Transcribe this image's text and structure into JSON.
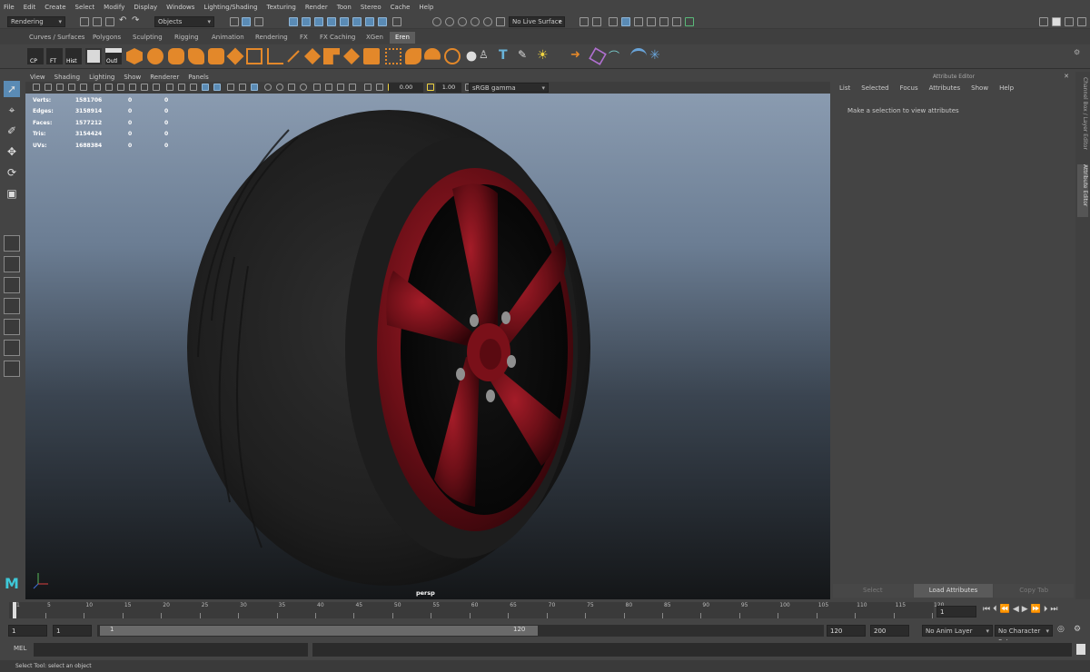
{
  "menubar": [
    "File",
    "Edit",
    "Create",
    "Select",
    "Modify",
    "Display",
    "Windows",
    "Lighting/Shading",
    "Texturing",
    "Render",
    "Toon",
    "Stereo",
    "Cache",
    "Help"
  ],
  "statusline": {
    "mode": "Rendering",
    "selection_mask": "Objects",
    "live_surface": "No Live Surface"
  },
  "shelf_tabs": [
    "Curves / Surfaces",
    "Polygons",
    "Sculpting",
    "Rigging",
    "Animation",
    "Rendering",
    "FX",
    "FX Caching",
    "XGen",
    "Eren"
  ],
  "shelf_active_tab": "Eren",
  "shelf_labels": [
    "CP",
    "FT",
    "Hist",
    "Outl"
  ],
  "viewport": {
    "menu": [
      "View",
      "Shading",
      "Lighting",
      "Show",
      "Renderer",
      "Panels"
    ],
    "exposure": "0.00",
    "gamma": "1.00",
    "color_space": "sRGB gamma",
    "camera": "persp",
    "hud": [
      {
        "label": "Verts:",
        "total": "1581706",
        "sel": "0",
        "comp": "0"
      },
      {
        "label": "Edges:",
        "total": "3158914",
        "sel": "0",
        "comp": "0"
      },
      {
        "label": "Faces:",
        "total": "1577212",
        "sel": "0",
        "comp": "0"
      },
      {
        "label": "Tris:",
        "total": "3154424",
        "sel": "0",
        "comp": "0"
      },
      {
        "label": "UVs:",
        "total": "1688384",
        "sel": "0",
        "comp": "0"
      }
    ]
  },
  "attribute_editor": {
    "title": "Attribute Editor",
    "menu": [
      "List",
      "Selected",
      "Focus",
      "Attributes",
      "Show",
      "Help"
    ],
    "message": "Make a selection to view attributes",
    "buttons": [
      "Select",
      "Load Attributes",
      "Copy Tab"
    ],
    "side_tabs": [
      "Channel Box / Layer Editor",
      "Attribute Editor"
    ]
  },
  "timeline": {
    "ticks": [
      "1",
      "5",
      "10",
      "15",
      "20",
      "25",
      "30",
      "35",
      "40",
      "45",
      "50",
      "55",
      "60",
      "65",
      "70",
      "75",
      "80",
      "85",
      "90",
      "95",
      "100",
      "105",
      "110",
      "115",
      "120"
    ],
    "current_frame": "1"
  },
  "range": {
    "start": "1",
    "playback_start": "1",
    "slider_start": "1",
    "slider_end": "120",
    "playback_end": "120",
    "end": "200",
    "anim_layer": "No Anim Layer",
    "character_set": "No Character Set"
  },
  "command_line": {
    "label": "MEL"
  },
  "help_line": "Select Tool: select an object",
  "colors": {
    "rim": "#6b0f17",
    "tire": "#1c1c1c",
    "accent_blue": "#5a8bb5"
  }
}
